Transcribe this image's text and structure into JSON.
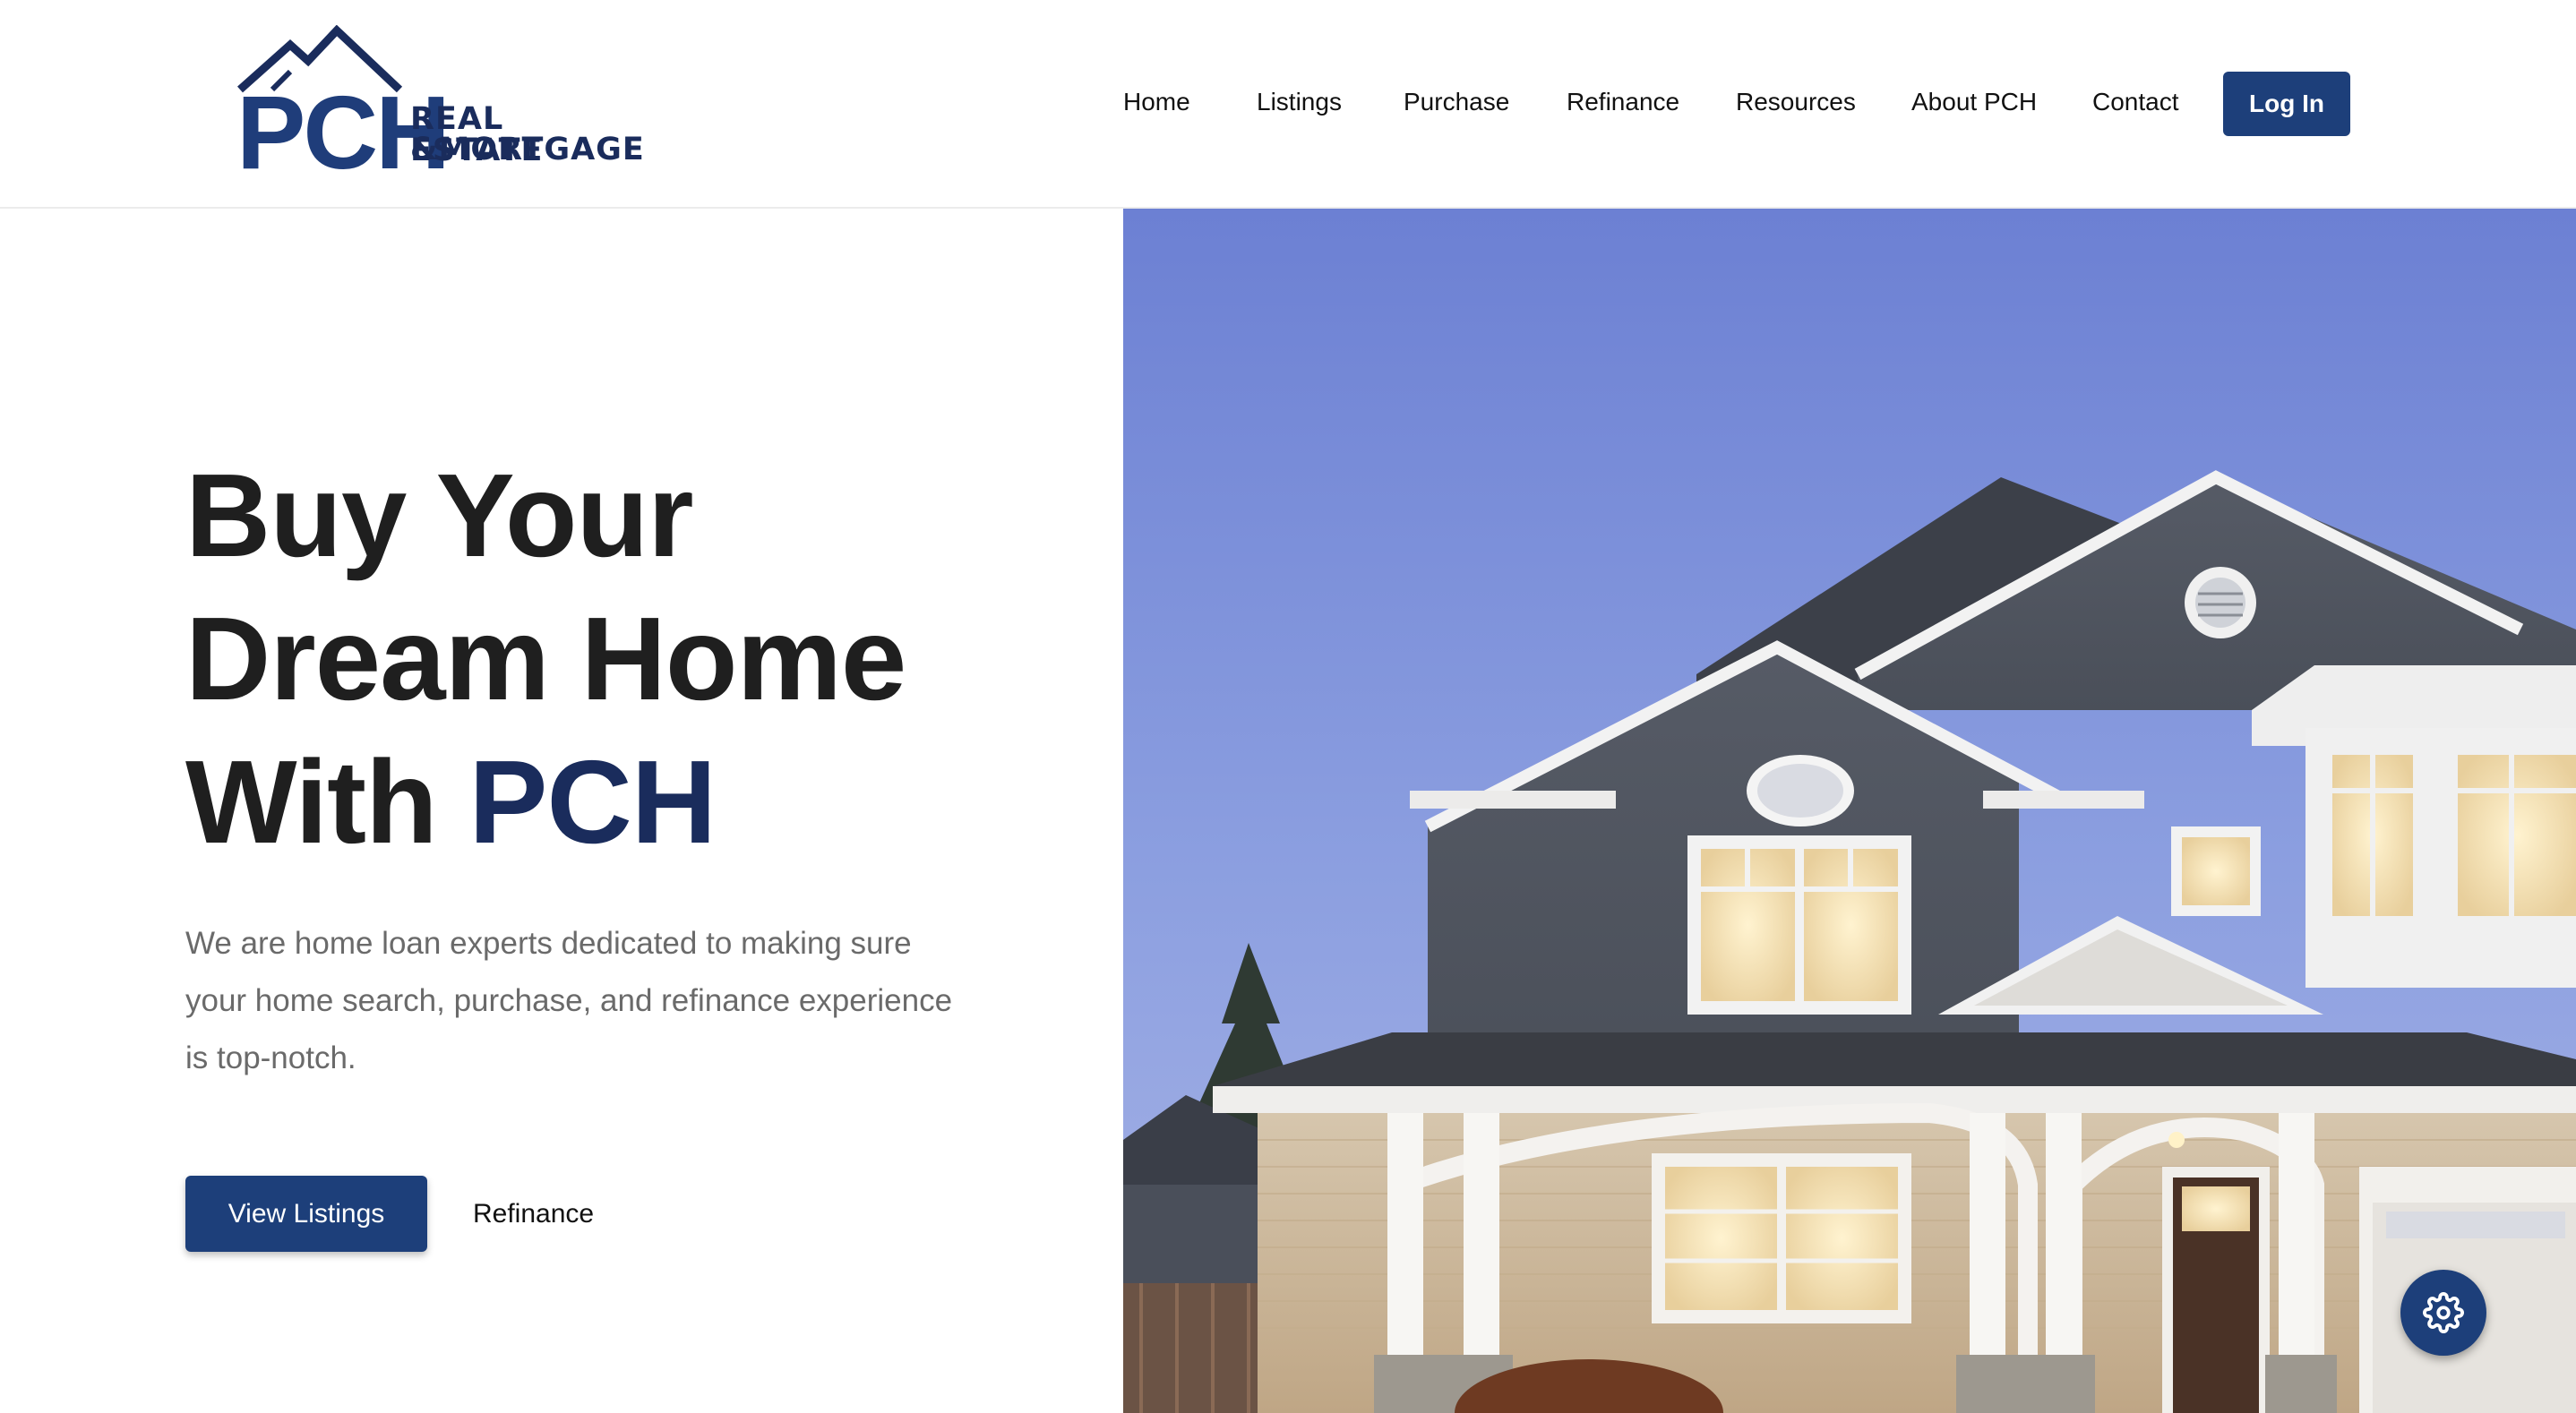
{
  "brand": {
    "logo_letters": "PCH",
    "logo_line1": "REAL ESTATE",
    "logo_line2": "&MORTGAGE",
    "primary_color": "#1d3f7a",
    "dark_navy": "#1a2c5c"
  },
  "nav": {
    "items": [
      {
        "label": "Home"
      },
      {
        "label": "Listings"
      },
      {
        "label": "Purchase"
      },
      {
        "label": "Refinance"
      },
      {
        "label": "Resources"
      },
      {
        "label": "About PCH"
      },
      {
        "label": "Contact"
      }
    ],
    "login_label": "Log In"
  },
  "hero": {
    "title_line1": "Buy Your",
    "title_line2": "Dream Home",
    "title_line3_prefix": "With",
    "title_accent": "PCH",
    "description": "We are home loan experts dedicated to making sure your home search, purchase, and refinance experience is top-notch.",
    "primary_button": "View Listings",
    "secondary_link": "Refinance"
  },
  "floating_button": {
    "icon": "gear-icon"
  }
}
